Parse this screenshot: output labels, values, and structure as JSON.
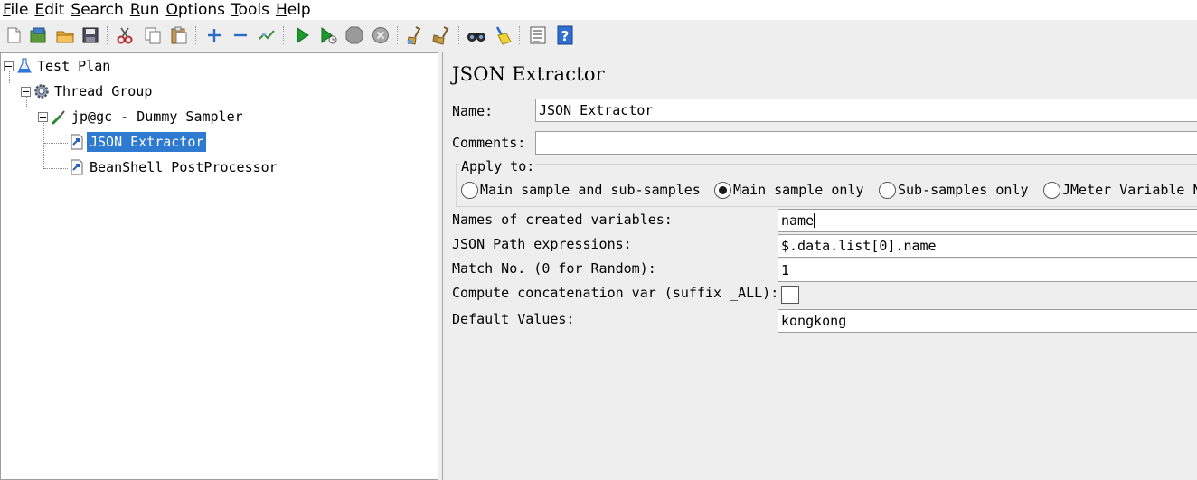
{
  "menubar": {
    "items": [
      "File",
      "Edit",
      "Search",
      "Run",
      "Options",
      "Tools",
      "Help"
    ]
  },
  "toolbar": {
    "buttons": [
      "new-icon",
      "templates-icon",
      "open-icon",
      "save-icon",
      "cut-icon",
      "copy-icon",
      "paste-icon",
      "expand-icon",
      "collapse-icon",
      "toggle-icon",
      "start-icon",
      "start-no-pauses-icon",
      "stop-icon",
      "shutdown-icon",
      "clear-icon",
      "clear-all-icon",
      "search-icon",
      "reset-search-icon",
      "function-helper-icon",
      "help-icon"
    ]
  },
  "tree": {
    "nodes": [
      {
        "label": "Test Plan",
        "icon": "flask-icon"
      },
      {
        "label": "Thread Group",
        "icon": "gear-icon"
      },
      {
        "label": "jp@gc - Dummy Sampler",
        "icon": "pipette-icon"
      },
      {
        "label": "JSON Extractor",
        "icon": "post-processor-icon"
      },
      {
        "label": "BeanShell PostProcessor",
        "icon": "post-processor-icon"
      }
    ]
  },
  "editor": {
    "title": "JSON Extractor",
    "name_label": "Name:",
    "name_value": "JSON Extractor",
    "comments_label": "Comments:",
    "comments_value": "",
    "apply_to": {
      "legend": "Apply to:",
      "options": [
        "Main sample and sub-samples",
        "Main sample only",
        "Sub-samples only",
        "JMeter Variable N"
      ],
      "selected": "Main sample only"
    },
    "fields": [
      {
        "label": "Names of created variables:",
        "value": "name"
      },
      {
        "label": "JSON Path expressions:",
        "value": "$.data.list[0].name"
      },
      {
        "label": "Match No. (0 for Random):",
        "value": "1"
      },
      {
        "label": "Compute concatenation var (suffix _ALL):",
        "checked": false
      },
      {
        "label": "Default Values:",
        "value": "kongkong"
      }
    ]
  }
}
